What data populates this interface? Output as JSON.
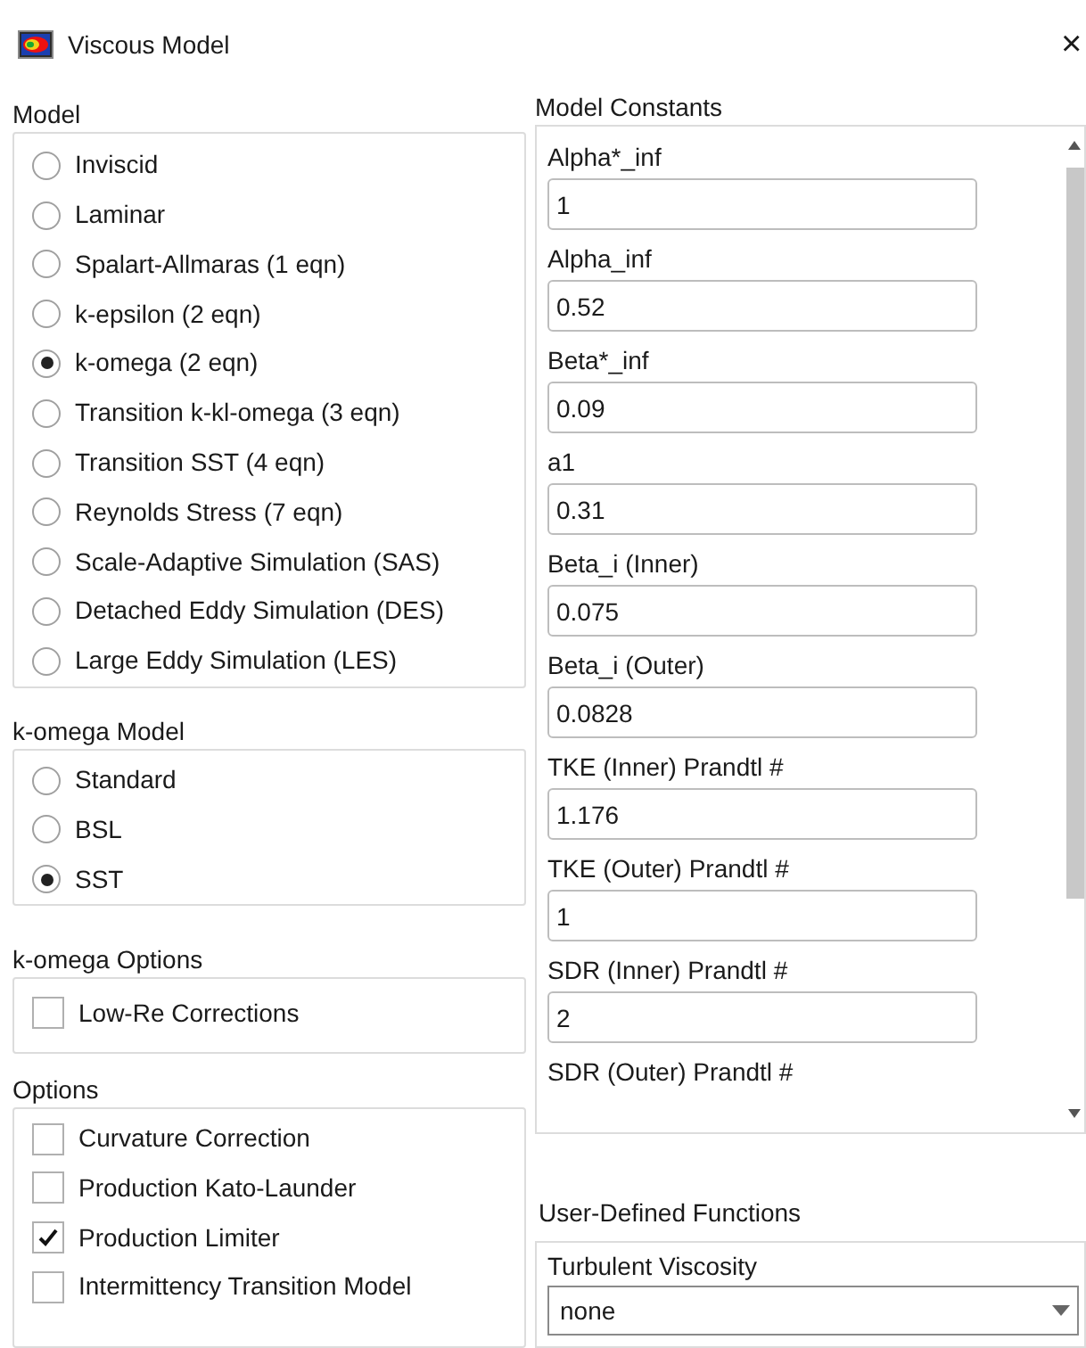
{
  "window": {
    "title": "Viscous Model",
    "close": "×"
  },
  "model": {
    "title": "Model",
    "options": [
      {
        "label": "Inviscid",
        "selected": false
      },
      {
        "label": "Laminar",
        "selected": false
      },
      {
        "label": "Spalart-Allmaras (1 eqn)",
        "selected": false
      },
      {
        "label": "k-epsilon (2 eqn)",
        "selected": false
      },
      {
        "label": "k-omega (2 eqn)",
        "selected": true
      },
      {
        "label": "Transition k-kl-omega (3 eqn)",
        "selected": false
      },
      {
        "label": "Transition SST (4 eqn)",
        "selected": false
      },
      {
        "label": "Reynolds Stress (7 eqn)",
        "selected": false
      },
      {
        "label": "Scale-Adaptive Simulation (SAS)",
        "selected": false
      },
      {
        "label": "Detached Eddy Simulation (DES)",
        "selected": false
      },
      {
        "label": "Large Eddy Simulation (LES)",
        "selected": false
      }
    ]
  },
  "k_omega_model": {
    "title": "k-omega Model",
    "options": [
      {
        "label": "Standard",
        "selected": false
      },
      {
        "label": "BSL",
        "selected": false
      },
      {
        "label": "SST",
        "selected": true
      }
    ]
  },
  "k_omega_options": {
    "title": "k-omega Options",
    "options": [
      {
        "label": "Low-Re Corrections",
        "checked": false
      }
    ]
  },
  "options": {
    "title": "Options",
    "options": [
      {
        "label": "Curvature Correction",
        "checked": false
      },
      {
        "label": "Production Kato-Launder",
        "checked": false
      },
      {
        "label": "Production Limiter",
        "checked": true
      },
      {
        "label": "Intermittency Transition Model",
        "checked": false
      }
    ]
  },
  "model_constants": {
    "title": "Model Constants",
    "fields": [
      {
        "label": "Alpha*_inf",
        "value": "1"
      },
      {
        "label": "Alpha_inf",
        "value": "0.52"
      },
      {
        "label": "Beta*_inf",
        "value": "0.09"
      },
      {
        "label": "a1",
        "value": "0.31"
      },
      {
        "label": "Beta_i (Inner)",
        "value": "0.075"
      },
      {
        "label": "Beta_i (Outer)",
        "value": "0.0828"
      },
      {
        "label": "TKE (Inner) Prandtl #",
        "value": "1.176"
      },
      {
        "label": "TKE (Outer) Prandtl #",
        "value": "1"
      },
      {
        "label": "SDR (Inner) Prandtl #",
        "value": "2"
      },
      {
        "label": "SDR (Outer) Prandtl #"
      }
    ]
  },
  "user_defined_functions": {
    "title": "User-Defined Functions",
    "fields": [
      {
        "label": "Turbulent Viscosity",
        "value": "none"
      }
    ]
  }
}
